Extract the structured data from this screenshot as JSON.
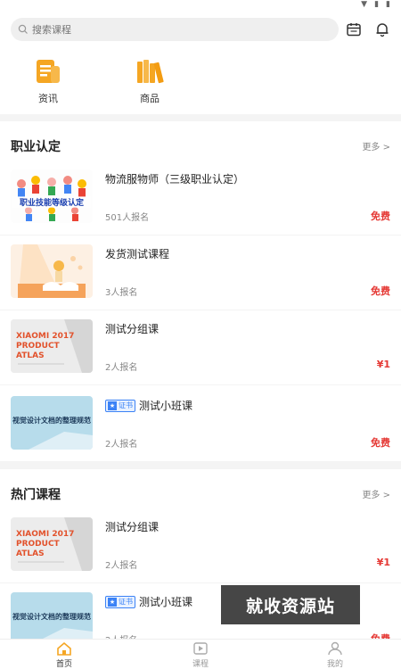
{
  "search": {
    "placeholder": "搜索课程"
  },
  "quick_links": [
    {
      "label": "资讯",
      "icon": "news-icon"
    },
    {
      "label": "商品",
      "icon": "goods-icon"
    }
  ],
  "sections": [
    {
      "title": "职业认定",
      "more": "更多 >",
      "courses": [
        {
          "title": "物流服物师（三级职业认定）",
          "enroll": "501人报名",
          "price": "免费",
          "thumb_text": "职业技能等级认定",
          "cert_badge": ""
        },
        {
          "title": "发货测试课程",
          "enroll": "3人报名",
          "price": "免费",
          "thumb_text": "",
          "cert_badge": ""
        },
        {
          "title": "测试分组课",
          "enroll": "2人报名",
          "price": "¥1",
          "thumb_text": "XIAOMI 2017 PRODUCT ATLAS",
          "cert_badge": ""
        },
        {
          "title": "测试小班课",
          "enroll": "2人报名",
          "price": "免费",
          "thumb_text": "视觉设计文档的整理规范",
          "cert_badge": "证书"
        }
      ]
    },
    {
      "title": "热门课程",
      "more": "更多 >",
      "courses": [
        {
          "title": "测试分组课",
          "enroll": "2人报名",
          "price": "¥1",
          "thumb_text": "XIAOMI 2017 PRODUCT ATLAS",
          "cert_badge": ""
        },
        {
          "title": "测试小班课",
          "enroll": "2人报名",
          "price": "免费",
          "thumb_text": "视觉设计文档的整理规范",
          "cert_badge": "证书"
        }
      ]
    }
  ],
  "watermark": "就收资源站",
  "tabs": [
    {
      "label": "首页",
      "active": true
    },
    {
      "label": "课程",
      "active": false
    },
    {
      "label": "我的",
      "active": false
    }
  ],
  "colors": {
    "accent": "#f5a623",
    "price": "#e53935",
    "badge": "#3b82f6"
  }
}
